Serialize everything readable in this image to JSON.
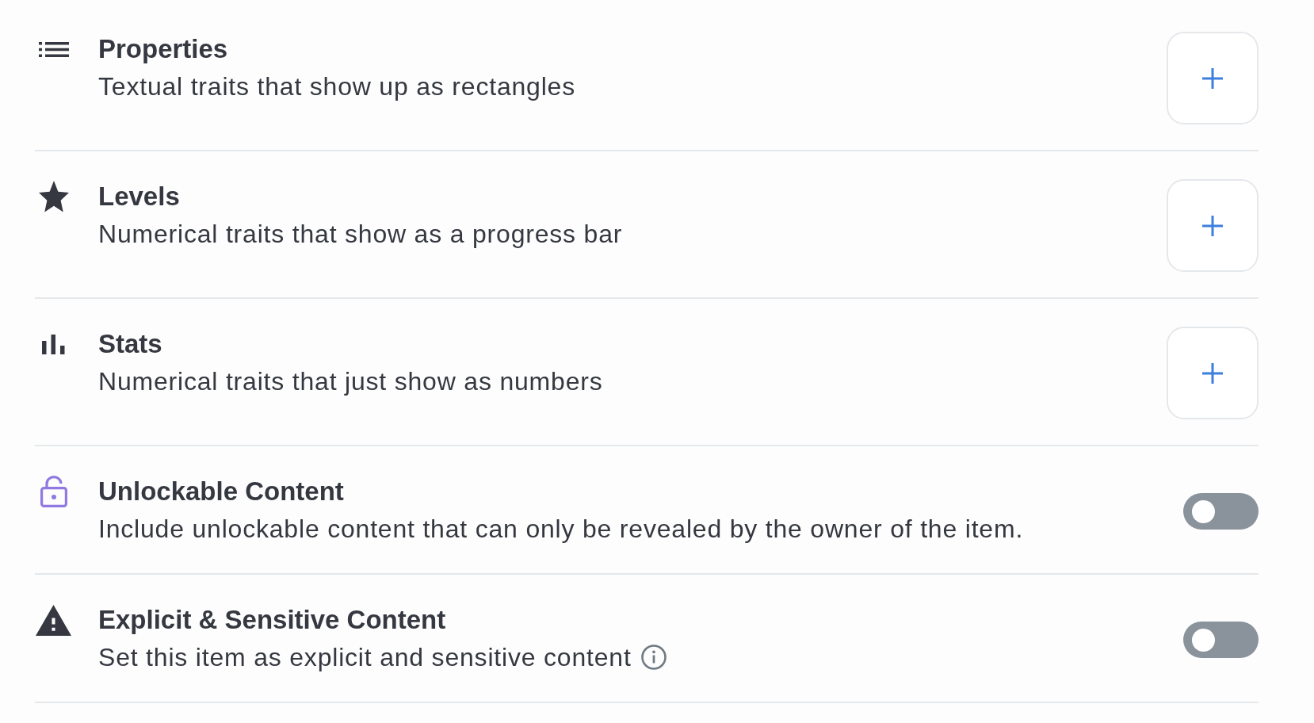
{
  "sections": [
    {
      "kind": "add",
      "title": "Properties",
      "description": "Textual traits that show up as rectangles",
      "info": false
    },
    {
      "kind": "add",
      "title": "Levels",
      "description": "Numerical traits that show as a progress bar",
      "info": false
    },
    {
      "kind": "add",
      "title": "Stats",
      "description": "Numerical traits that just show as numbers",
      "info": false
    },
    {
      "kind": "toggle",
      "title": "Unlockable Content",
      "description": "Include unlockable content that can only be revealed by the owner of the item.",
      "on": false,
      "info": false
    },
    {
      "kind": "toggle",
      "title": "Explicit & Sensitive Content",
      "description": "Set this item as explicit and sensitive content",
      "on": false,
      "info": true
    }
  ]
}
